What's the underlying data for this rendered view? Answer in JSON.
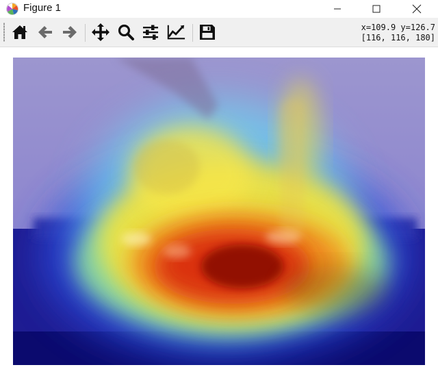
{
  "window": {
    "title": "Figure 1",
    "icon": "matplotlib-logo-icon",
    "controls": [
      "minimize-icon",
      "maximize-icon",
      "close-icon"
    ]
  },
  "toolbar": {
    "buttons": [
      {
        "name": "home",
        "icon": "home-icon"
      },
      {
        "name": "back",
        "icon": "arrow-left-icon"
      },
      {
        "name": "forward",
        "icon": "arrow-right-icon"
      },
      {
        "name": "pan",
        "icon": "move-icon"
      },
      {
        "name": "zoom",
        "icon": "magnifier-icon"
      },
      {
        "name": "configure-subplots",
        "icon": "sliders-icon"
      },
      {
        "name": "edit-axis",
        "icon": "line-chart-icon"
      },
      {
        "name": "save",
        "icon": "floppy-disk-icon"
      }
    ],
    "coord_readout": "x=109.9 y=126.7",
    "pixel_readout": "[116, 116, 180]"
  },
  "figure": {
    "content": "image with heatmap overlay",
    "colors": {
      "heat_core": "#8b0a00",
      "heat_red": "#d92a0a",
      "heat_orange": "#f08a1a",
      "heat_yellow": "#f3e23c",
      "heat_green": "#9be08a",
      "heat_cyan": "#7fd6e6",
      "heat_blue": "#2a2ad0",
      "heat_navy": "#0a0a80",
      "background_lavender": "#8f8ad4"
    }
  }
}
